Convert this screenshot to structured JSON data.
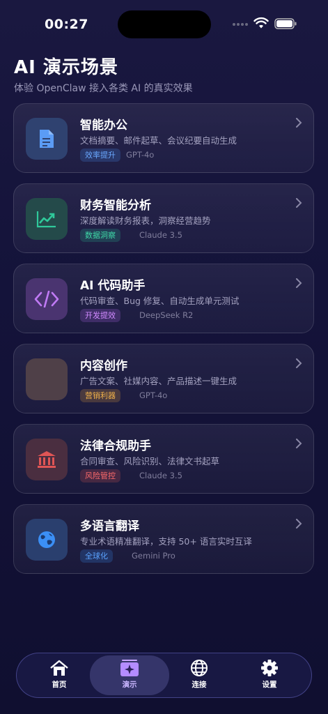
{
  "status_bar": {
    "time": "00:27"
  },
  "header": {
    "title": "AI 演示场景",
    "subtitle": "体验 OpenClaw 接入各类 AI 的真实效果"
  },
  "scenarios": [
    {
      "title": "智能办公",
      "desc": "文档摘要、邮件起草、会议纪要自动生成",
      "tag": "效率提升",
      "model": "GPT-4o",
      "icon": "document-icon",
      "accent": "#4a8ff0"
    },
    {
      "title": "财务智能分析",
      "desc": "深度解读财务报表，洞察经营趋势",
      "tag": "数据洞察",
      "model": "Claude 3.5",
      "icon": "trend-chart-icon",
      "accent": "#2fc99a"
    },
    {
      "title": "AI 代码助手",
      "desc": "代码审查、Bug 修复、自动生成单元测试",
      "tag": "开发提效",
      "model": "DeepSeek R2",
      "icon": "code-icon",
      "accent": "#b86af0"
    },
    {
      "title": "内容创作",
      "desc": "广告文案、社媒内容、产品描述一键生成",
      "tag": "营销利器",
      "model": "GPT-4o",
      "icon": "content-icon",
      "accent": "#e8a23a"
    },
    {
      "title": "法律合规助手",
      "desc": "合同审查、风险识别、法律文书起草",
      "tag": "风险管控",
      "model": "Claude 3.5",
      "icon": "courthouse-icon",
      "accent": "#e05555"
    },
    {
      "title": "多语言翻译",
      "desc": "专业术语精准翻译，支持 50+ 语言实时互译",
      "tag": "全球化",
      "model": "Gemini Pro",
      "icon": "globe-icon",
      "accent": "#3b8ff5"
    }
  ],
  "tab_bar": {
    "tabs": [
      {
        "label": "首页",
        "icon": "home-icon"
      },
      {
        "label": "演示",
        "icon": "sparkle-icon",
        "active": true
      },
      {
        "label": "连接",
        "icon": "globe-icon"
      },
      {
        "label": "设置",
        "icon": "gear-icon"
      }
    ]
  }
}
